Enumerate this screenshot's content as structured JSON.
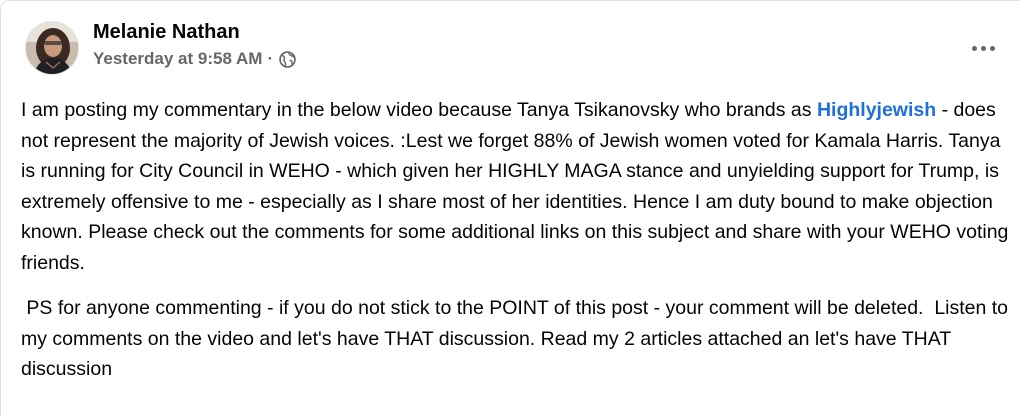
{
  "post": {
    "author": "Melanie Nathan",
    "timestamp": "Yesterday at 9:58 AM",
    "separator": "·",
    "audience_icon": "globe-icon",
    "more_icon": "more-options-icon",
    "paragraph1": {
      "part1": "I am posting my commentary in the below video because Tanya Tsikanovsky who brands as",
      "tag": "Highlyjewish",
      "part2": " - does not represent the majority of Jewish voices. :Lest we forget 88% of Jewish women voted for Kamala Harris. Tanya is running for City Council in WEHO - which given her HIGHLY MAGA stance and unyielding support for Trump, is extremely offensive to me - especially as I share most of her identities. Hence I am duty bound to make objection known. Please check out the comments for some additional links on this subject and share with your WEHO voting friends."
    },
    "paragraph2": " PS for anyone commenting - if you do not stick to the POINT of this post - your comment will be deleted.  Listen to my comments on the video and let's have THAT discussion. Read my 2 articles attached an let's have THAT discussion",
    "colors": {
      "tag": "#216fdb",
      "secondary_text": "#65676b"
    }
  }
}
